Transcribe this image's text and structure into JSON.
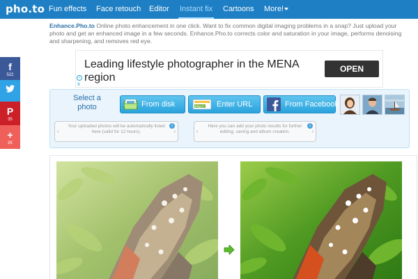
{
  "header": {
    "logo": "pho.to",
    "nav": [
      {
        "label": "Fun effects"
      },
      {
        "label": "Face retouch"
      },
      {
        "label": "Editor"
      },
      {
        "label": "Instant fix",
        "active": true
      },
      {
        "label": "Cartoons"
      },
      {
        "label": "More!"
      }
    ]
  },
  "intro": {
    "brand": "Enhance.Pho.to",
    "text": "Online photo enhancement in one click. Want to fix common digital imaging problems in a snap? Just upload your photo and get an enhanced image in a few seconds. Enhance.Pho.to corrects color and saturation in your image, performs denoising and sharpening, and removes red eye."
  },
  "ad": {
    "title": "Leading lifestyle photographer in the MENA region",
    "cta": "OPEN",
    "info_icon": "i",
    "close_icon": "x"
  },
  "social": [
    {
      "icon": "facebook-icon",
      "glyph": "f",
      "count": "522",
      "color": "#3b5998"
    },
    {
      "icon": "twitter-icon",
      "glyph": "🐦",
      "count": "",
      "color": "#2fa3e6"
    },
    {
      "icon": "pinterest-icon",
      "glyph": "P",
      "count": "35",
      "color": "#cb2027"
    },
    {
      "icon": "plus-icon",
      "glyph": "+",
      "count": "2K",
      "color": "#f0605a"
    }
  ],
  "upload": {
    "select_label": "Select a photo",
    "buttons": [
      {
        "label": "From disk",
        "icon": "folder-icon"
      },
      {
        "label": "Enter URL",
        "icon": "link-icon"
      },
      {
        "label": "From Facebook",
        "icon": "facebook-icon"
      }
    ],
    "notes": [
      {
        "text": "Your uploaded photos will be automatically listed here (valid for 12 hours)."
      },
      {
        "text": "Here you can add your photo results for further editing, saving and album creation."
      }
    ]
  },
  "colors": {
    "nav_bg": "#1e7fc4",
    "nav_active": "#a8ddff",
    "button_bg": "#2aa3dd",
    "panel_bg": "#e9f4fc",
    "ad_cta_bg": "#333333"
  }
}
